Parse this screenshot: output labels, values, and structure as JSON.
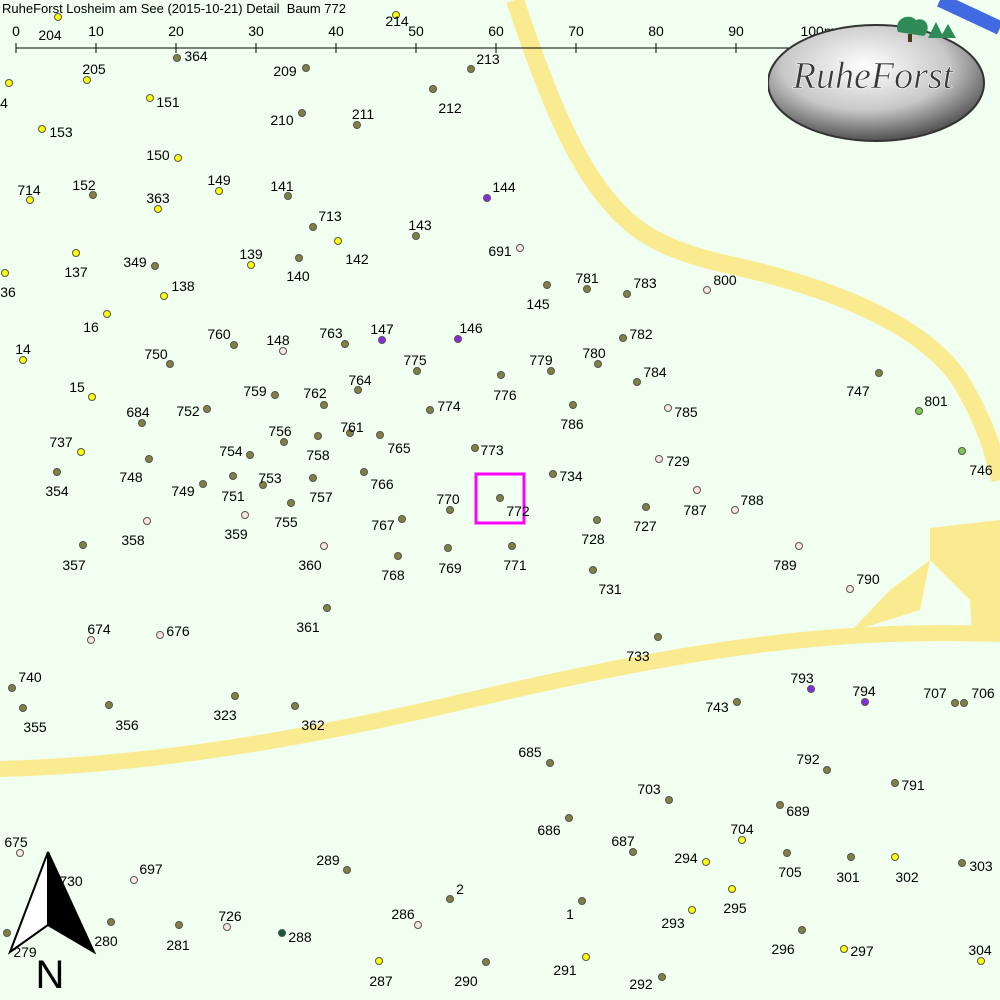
{
  "title": "RuheForst Losheim am See (2015-10-21) Detail  Baum 772",
  "logo_text": "RuheForst",
  "north_label": "N",
  "scale": {
    "ticks": [
      "0",
      "10",
      "20",
      "30",
      "40",
      "50",
      "60",
      "70",
      "80",
      "90",
      "100m"
    ]
  },
  "colors": {
    "background": "#f0fff0",
    "path": "#faeb90",
    "water": "#4169e1",
    "highlight": "#ff00ff",
    "olive": "#808040",
    "yellow": "#ffff00",
    "pink": "#ffe4e1",
    "purple": "#8a2be2",
    "green": "#7ec850",
    "dark_green": "#0b5a3a"
  },
  "selected_tree": "772",
  "trees": [
    {
      "id": "204",
      "c": "yellow"
    },
    {
      "id": "214",
      "c": "yellow"
    },
    {
      "id": "364",
      "c": "olive"
    },
    {
      "id": "205",
      "c": "yellow"
    },
    {
      "id": "209",
      "c": "olive"
    },
    {
      "id": "213",
      "c": "olive"
    },
    {
      "id": "4",
      "c": "yellow"
    },
    {
      "id": "151",
      "c": "yellow"
    },
    {
      "id": "212",
      "c": "olive"
    },
    {
      "id": "210",
      "c": "olive"
    },
    {
      "id": "211",
      "c": "olive"
    },
    {
      "id": "153",
      "c": "yellow"
    },
    {
      "id": "150",
      "c": "yellow"
    },
    {
      "id": "714",
      "c": "yellow"
    },
    {
      "id": "152",
      "c": "olive"
    },
    {
      "id": "149",
      "c": "yellow"
    },
    {
      "id": "141",
      "c": "olive"
    },
    {
      "id": "144",
      "c": "purple"
    },
    {
      "id": "363",
      "c": "yellow"
    },
    {
      "id": "713",
      "c": "olive"
    },
    {
      "id": "143",
      "c": "olive"
    },
    {
      "id": "691",
      "c": "pink"
    },
    {
      "id": "137",
      "c": "yellow"
    },
    {
      "id": "349",
      "c": "olive"
    },
    {
      "id": "139",
      "c": "yellow"
    },
    {
      "id": "142",
      "c": "yellow"
    },
    {
      "id": "140",
      "c": "olive"
    },
    {
      "id": "36",
      "c": "yellow"
    },
    {
      "id": "138",
      "c": "yellow"
    },
    {
      "id": "781",
      "c": "olive"
    },
    {
      "id": "783",
      "c": "olive"
    },
    {
      "id": "800",
      "c": "pink"
    },
    {
      "id": "145",
      "c": "olive"
    },
    {
      "id": "16",
      "c": "yellow"
    },
    {
      "id": "760",
      "c": "olive"
    },
    {
      "id": "148",
      "c": "pink"
    },
    {
      "id": "763",
      "c": "olive"
    },
    {
      "id": "147",
      "c": "purple"
    },
    {
      "id": "146",
      "c": "purple"
    },
    {
      "id": "782",
      "c": "olive"
    },
    {
      "id": "14",
      "c": "yellow"
    },
    {
      "id": "750",
      "c": "olive"
    },
    {
      "id": "775",
      "c": "olive"
    },
    {
      "id": "779",
      "c": "olive"
    },
    {
      "id": "780",
      "c": "olive"
    },
    {
      "id": "784",
      "c": "olive"
    },
    {
      "id": "747",
      "c": "olive"
    },
    {
      "id": "764",
      "c": "olive"
    },
    {
      "id": "15",
      "c": "yellow"
    },
    {
      "id": "759",
      "c": "olive"
    },
    {
      "id": "762",
      "c": "olive"
    },
    {
      "id": "776",
      "c": "olive"
    },
    {
      "id": "801",
      "c": "green"
    },
    {
      "id": "684",
      "c": "olive"
    },
    {
      "id": "752",
      "c": "olive"
    },
    {
      "id": "774",
      "c": "olive"
    },
    {
      "id": "785",
      "c": "pink"
    },
    {
      "id": "786",
      "c": "olive"
    },
    {
      "id": "761",
      "c": "olive"
    },
    {
      "id": "756",
      "c": "olive"
    },
    {
      "id": "737",
      "c": "yellow"
    },
    {
      "id": "758",
      "c": "olive"
    },
    {
      "id": "765",
      "c": "olive"
    },
    {
      "id": "754",
      "c": "olive"
    },
    {
      "id": "773",
      "c": "olive"
    },
    {
      "id": "746",
      "c": "green"
    },
    {
      "id": "729",
      "c": "pink"
    },
    {
      "id": "748",
      "c": "olive"
    },
    {
      "id": "734",
      "c": "olive"
    },
    {
      "id": "354",
      "c": "olive"
    },
    {
      "id": "753",
      "c": "olive"
    },
    {
      "id": "766",
      "c": "olive"
    },
    {
      "id": "749",
      "c": "olive"
    },
    {
      "id": "751",
      "c": "olive"
    },
    {
      "id": "757",
      "c": "olive"
    },
    {
      "id": "770",
      "c": "olive"
    },
    {
      "id": "772",
      "c": "olive"
    },
    {
      "id": "788",
      "c": "pink"
    },
    {
      "id": "787",
      "c": "pink"
    },
    {
      "id": "755",
      "c": "olive"
    },
    {
      "id": "727",
      "c": "olive"
    },
    {
      "id": "767",
      "c": "olive"
    },
    {
      "id": "358",
      "c": "pink"
    },
    {
      "id": "359",
      "c": "pink"
    },
    {
      "id": "728",
      "c": "olive"
    },
    {
      "id": "357",
      "c": "olive"
    },
    {
      "id": "360",
      "c": "pink"
    },
    {
      "id": "769",
      "c": "olive"
    },
    {
      "id": "771",
      "c": "olive"
    },
    {
      "id": "789",
      "c": "pink"
    },
    {
      "id": "768",
      "c": "olive"
    },
    {
      "id": "790",
      "c": "pink"
    },
    {
      "id": "731",
      "c": "olive"
    },
    {
      "id": "361",
      "c": "olive"
    },
    {
      "id": "674",
      "c": "pink"
    },
    {
      "id": "676",
      "c": "pink"
    },
    {
      "id": "733",
      "c": "olive"
    },
    {
      "id": "740",
      "c": "olive"
    },
    {
      "id": "793",
      "c": "purple"
    },
    {
      "id": "794",
      "c": "purple"
    },
    {
      "id": "707",
      "c": "olive"
    },
    {
      "id": "706",
      "c": "olive"
    },
    {
      "id": "743",
      "c": "olive"
    },
    {
      "id": "355",
      "c": "olive"
    },
    {
      "id": "356",
      "c": "olive"
    },
    {
      "id": "323",
      "c": "olive"
    },
    {
      "id": "362",
      "c": "olive"
    },
    {
      "id": "685",
      "c": "olive"
    },
    {
      "id": "792",
      "c": "olive"
    },
    {
      "id": "703",
      "c": "olive"
    },
    {
      "id": "791",
      "c": "olive"
    },
    {
      "id": "689",
      "c": "olive"
    },
    {
      "id": "686",
      "c": "olive"
    },
    {
      "id": "687",
      "c": "olive"
    },
    {
      "id": "704",
      "c": "yellow"
    },
    {
      "id": "675",
      "c": "pink"
    },
    {
      "id": "294",
      "c": "yellow"
    },
    {
      "id": "289",
      "c": "olive"
    },
    {
      "id": "705",
      "c": "olive"
    },
    {
      "id": "301",
      "c": "olive"
    },
    {
      "id": "302",
      "c": "yellow"
    },
    {
      "id": "303",
      "c": "olive"
    },
    {
      "id": "730",
      "c": "olive"
    },
    {
      "id": "697",
      "c": "pink"
    },
    {
      "id": "2",
      "c": "olive"
    },
    {
      "id": "295",
      "c": "yellow"
    },
    {
      "id": "1",
      "c": "olive"
    },
    {
      "id": "293",
      "c": "yellow"
    },
    {
      "id": "726",
      "c": "pink"
    },
    {
      "id": "286",
      "c": "pink"
    },
    {
      "id": "280",
      "c": "olive"
    },
    {
      "id": "281",
      "c": "olive"
    },
    {
      "id": "288",
      "c": "dark_green"
    },
    {
      "id": "296",
      "c": "olive"
    },
    {
      "id": "297",
      "c": "yellow"
    },
    {
      "id": "279",
      "c": "olive"
    },
    {
      "id": "304",
      "c": "yellow"
    },
    {
      "id": "291",
      "c": "yellow"
    },
    {
      "id": "287",
      "c": "yellow"
    },
    {
      "id": "290",
      "c": "olive"
    },
    {
      "id": "292",
      "c": "olive"
    }
  ]
}
